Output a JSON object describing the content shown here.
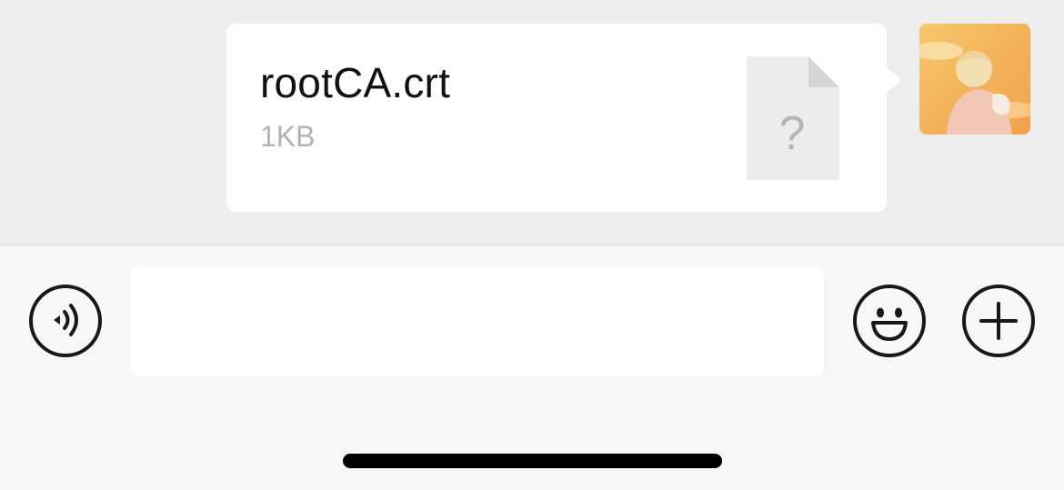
{
  "message": {
    "file_name": "rootCA.crt",
    "file_size": "1KB",
    "file_icon": "unknown-file-icon",
    "file_icon_glyph": "?"
  },
  "avatar": {
    "icon": "user-avatar"
  },
  "input_bar": {
    "voice_icon": "voice-icon",
    "text_value": "",
    "emoji_icon": "emoji-icon",
    "plus_icon": "plus-icon"
  },
  "colors": {
    "chat_background": "#ededed",
    "bubble": "#ffffff",
    "input_bar": "#f7f7f7",
    "file_size_text": "#b2b2b2"
  }
}
